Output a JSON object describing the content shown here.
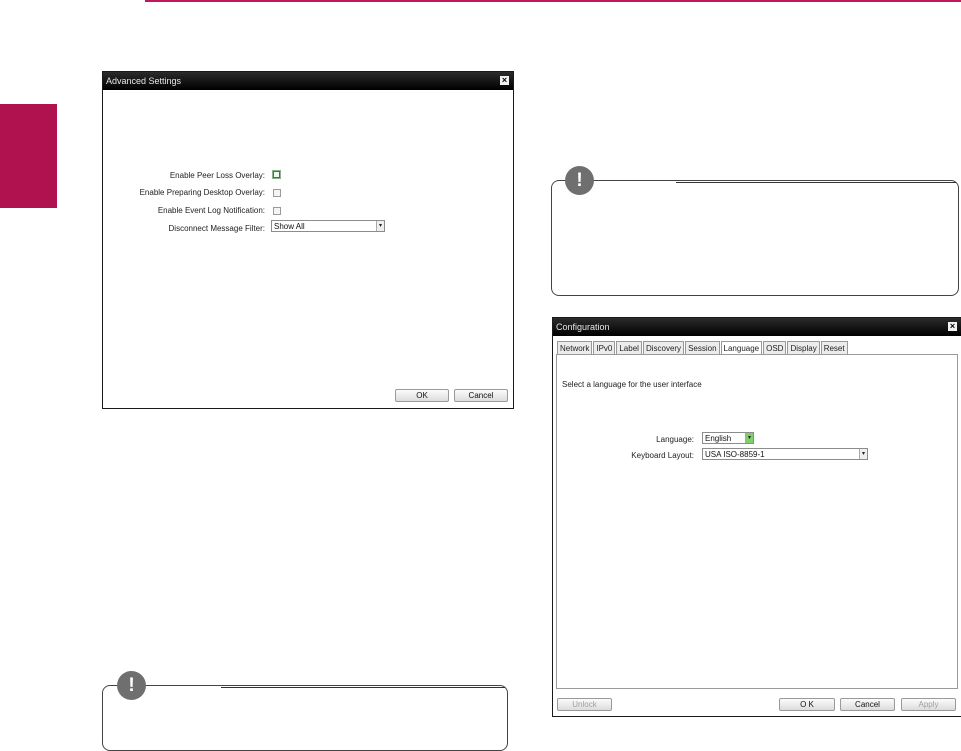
{
  "decor": {
    "accent": "#c2185b",
    "sidetab": "#b0124f"
  },
  "advanced": {
    "title": "Advanced Settings",
    "close_glyph": "×",
    "fields": {
      "peer_loss": "Enable Peer Loss Overlay:",
      "preparing_desktop": "Enable Preparing Desktop Overlay:",
      "event_log": "Enable Event Log Notification:",
      "disconnect_filter": "Disconnect Message Filter:"
    },
    "filter_value": "Show All",
    "checkboxes": {
      "peer_loss": false,
      "preparing_desktop": false,
      "event_log": false
    },
    "ok": "OK",
    "cancel": "Cancel"
  },
  "notes": {
    "icon_glyph": "!"
  },
  "config": {
    "title": "Configuration",
    "close_glyph": "×",
    "tabs": [
      "Network",
      "IPv0",
      "Label",
      "Discovery",
      "Session",
      "Language",
      "OSD",
      "Display",
      "Reset"
    ],
    "active_tab": "Language",
    "description": "Select a language for the user interface",
    "language_label": "Language:",
    "language_value": "English",
    "keyboard_label": "Keyboard Layout:",
    "keyboard_value": "USA ISO-8859-1",
    "unlock": "Unlock",
    "ok": "O K",
    "cancel": "Cancel",
    "apply": "Apply"
  }
}
